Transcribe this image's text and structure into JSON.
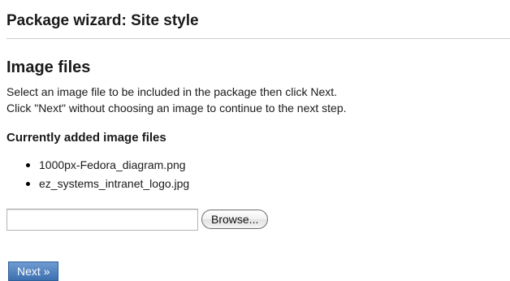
{
  "header": {
    "title": "Package wizard: Site style"
  },
  "section": {
    "title": "Image files",
    "instruction_line_1": "Select an image file to be included in the package then click Next.",
    "instruction_line_2": "Click \"Next\" without choosing an image to continue to the next step."
  },
  "added_files": {
    "title": "Currently added image files",
    "items": [
      "1000px-Fedora_diagram.png",
      "ez_systems_intranet_logo.jpg"
    ]
  },
  "upload": {
    "file_value": "",
    "browse_label": "Browse..."
  },
  "actions": {
    "next_label": "Next »"
  },
  "colors": {
    "next_button_bg": "#4a7fbf",
    "rule": "#cccccc"
  }
}
